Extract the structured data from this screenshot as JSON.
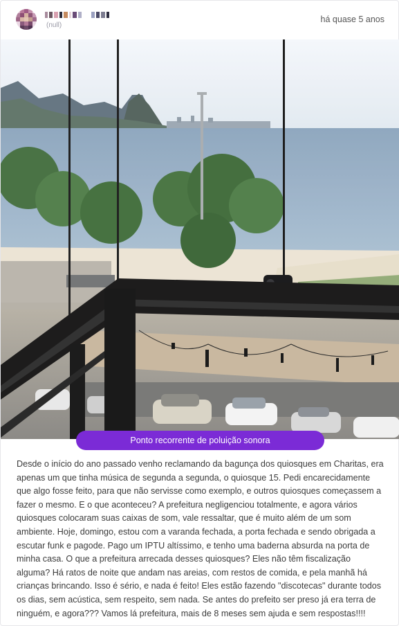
{
  "post": {
    "author_sub": "(null)",
    "timestamp": "há quase 5 anos",
    "tag": "Ponto recorrente de poluição sonora",
    "description": "Desde o início do ano passado venho reclamando da bagunça dos quiosques em Charitas, era apenas um que tinha música de segunda a segunda, o quiosque 15. Pedi encarecidamente que algo fosse feito, para que não servisse como exemplo, e outros quiosques começassem a fazer o mesmo. E o que aconteceu? A prefeitura negligenciou totalmente, e agora vários quiosques colocaram suas caixas de som, vale ressaltar, que é muito além de um som ambiente. Hoje, domingo, estou com a varanda fechada, a porta fechada e sendo obrigada a escutar funk e pagode. Pago um IPTU altíssimo, e tenho uma baderna absurda na porta de minha casa. O que a prefeitura arrecada desses quiosques? Eles não têm fiscalização alguma? Há ratos de noite que andam nas areias, com restos de comida, e pela manhã há crianças brincando. Isso é sério, e nada é feito! Eles estão fazendo \"discotecas\" durante todos os dias, sem acústica, sem respeito, sem nada. Se antes do prefeito ser preso já era terra de ninguém, e agora??? Vamos lá prefeitura, mais de 8 meses sem ajuda e sem respostas!!!!"
  },
  "colors": {
    "tag_background": "#7b2bd6",
    "tag_text": "#ffffff",
    "muted_text": "#9a9aa6"
  }
}
